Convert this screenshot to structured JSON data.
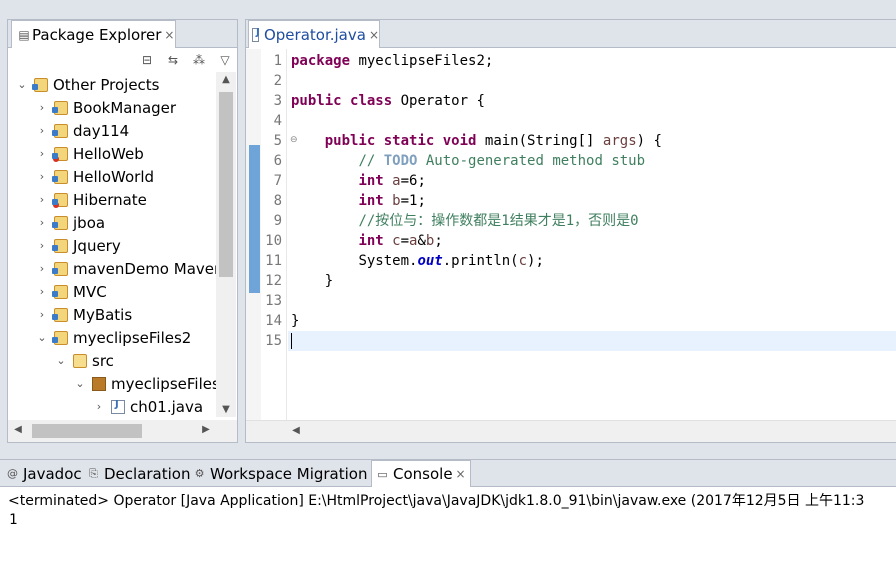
{
  "package_explorer": {
    "tab_label": "Package Explorer",
    "close_glyph": "×",
    "tree": [
      {
        "label": "Other Projects",
        "chev": "v",
        "icon": "working-set-icon"
      },
      {
        "label": "BookManager",
        "chev": ">",
        "icon": "project-icon"
      },
      {
        "label": "day114",
        "chev": ">",
        "icon": "project-icon"
      },
      {
        "label": "HelloWeb",
        "chev": ">",
        "icon": "project-error-icon"
      },
      {
        "label": "HelloWorld",
        "chev": ">",
        "icon": "project-icon"
      },
      {
        "label": "Hibernate",
        "chev": ">",
        "icon": "project-error-icon"
      },
      {
        "label": "jboa",
        "chev": ">",
        "icon": "project-icon"
      },
      {
        "label": "Jquery",
        "chev": ">",
        "icon": "project-icon"
      },
      {
        "label": "mavenDemo Maven",
        "chev": ">",
        "icon": "maven-project-icon"
      },
      {
        "label": "MVC",
        "chev": ">",
        "icon": "project-icon"
      },
      {
        "label": "MyBatis",
        "chev": ">",
        "icon": "project-icon"
      },
      {
        "label": "myeclipseFiles2",
        "chev": "v",
        "icon": "project-icon"
      },
      {
        "label": "src",
        "chev": "v",
        "icon": "source-folder-icon"
      },
      {
        "label": "myeclipseFiles",
        "chev": "v",
        "icon": "package-icon"
      },
      {
        "label": "ch01.java",
        "chev": ">",
        "icon": "java-file-icon"
      }
    ]
  },
  "editor": {
    "tab_label": "Operator.java",
    "close_glyph": "×",
    "line_numbers": [
      "1",
      "2",
      "3",
      "4",
      "5",
      "6",
      "7",
      "8",
      "9",
      "10",
      "11",
      "12",
      "13",
      "14",
      "15"
    ],
    "code": {
      "l1_kw": "package",
      "l1_rest": " myeclipseFiles2;",
      "l3_kw1": "public",
      "l3_kw2": "class",
      "l3_rest": " Operator {",
      "l5_kw1": "public",
      "l5_kw2": "static",
      "l5_kw3": "void",
      "l5_a": " main(String[] ",
      "l5_var": "args",
      "l5_b": ") {",
      "l6_c1": "// ",
      "l6_todo": "TODO",
      "l6_c2": " Auto-generated method stub",
      "l7_kw": "int",
      "l7_var": "a",
      "l7_rest": "=6;",
      "l8_kw": "int",
      "l8_var": "b",
      "l8_rest": "=1;",
      "l9_comment": "//按位与：操作数都是1结果才是1，否则是0",
      "l10_kw": "int",
      "l10_var": "c",
      "l10_a": "=",
      "l10_var2": "a",
      "l10_b": "&",
      "l10_var3": "b",
      "l10_c": ";",
      "l11_a": "System.",
      "l11_fld": "out",
      "l11_b": ".println(",
      "l11_var": "c",
      "l11_c": ");",
      "l12": "}",
      "l14": "}"
    }
  },
  "bottom": {
    "tabs": [
      "Javadoc",
      "Declaration",
      "Workspace Migration",
      "Console"
    ],
    "console_close": "×",
    "console_header": "<terminated> Operator [Java Application] E:\\HtmlProject\\java\\JavaJDK\\jdk1.8.0_91\\bin\\javaw.exe (2017年12月5日 上午11:3",
    "console_output": "1"
  },
  "colors": {
    "keyword": "#7f0055",
    "comment": "#3f7f5f",
    "field": "#0000c0",
    "current_line": "#e8f2fe"
  }
}
